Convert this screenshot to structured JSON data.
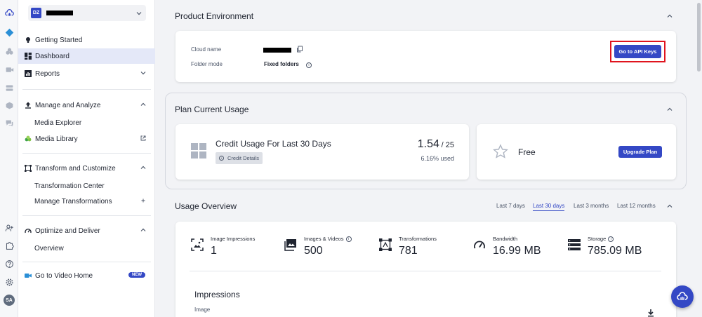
{
  "colors": {
    "accent": "#3448c5",
    "highlight": "#e0141e"
  },
  "cloud_selector": {
    "initials": "DZ"
  },
  "sidebar": {
    "getting_started": "Getting Started",
    "dashboard": "Dashboard",
    "reports": "Reports",
    "manage_analyze": "Manage and Analyze",
    "media_explorer": "Media Explorer",
    "media_library": "Media Library",
    "transform_customize": "Transform and Customize",
    "transformation_center": "Transformation Center",
    "manage_transformations": "Manage Transformations",
    "optimize_deliver": "Optimize and Deliver",
    "overview": "Overview",
    "video_home": "Go to Video Home",
    "new_badge": "NEW"
  },
  "rail": {
    "avatar_initials": "SA"
  },
  "product_environment": {
    "title": "Product Environment",
    "cloud_name_label": "Cloud name",
    "folder_mode_label": "Folder mode",
    "folder_mode_value": "Fixed folders",
    "api_keys_button": "Go to API Keys"
  },
  "plan_usage": {
    "title": "Plan Current Usage",
    "credit_title": "Credit Usage For Last 30 Days",
    "credit_details": "Credit Details",
    "credit_used": "1.54",
    "credit_total": "/ 25",
    "credit_percent": "6.16% used",
    "plan_name": "Free",
    "upgrade_button": "Upgrade Plan"
  },
  "usage_overview": {
    "title": "Usage Overview",
    "ranges": [
      "Last 7 days",
      "Last 30 days",
      "Last 3 months",
      "Last 12 months"
    ],
    "active_range": "Last 30 days",
    "metrics": [
      {
        "label": "Image Impressions",
        "value": "1"
      },
      {
        "label": "Images & Videos",
        "value": "500"
      },
      {
        "label": "Transformations",
        "value": "781"
      },
      {
        "label": "Bandwidth",
        "value": "16.99 MB"
      },
      {
        "label": "Storage",
        "value": "785.09 MB"
      }
    ],
    "impressions_title": "Impressions",
    "impressions_sub": "Image"
  }
}
